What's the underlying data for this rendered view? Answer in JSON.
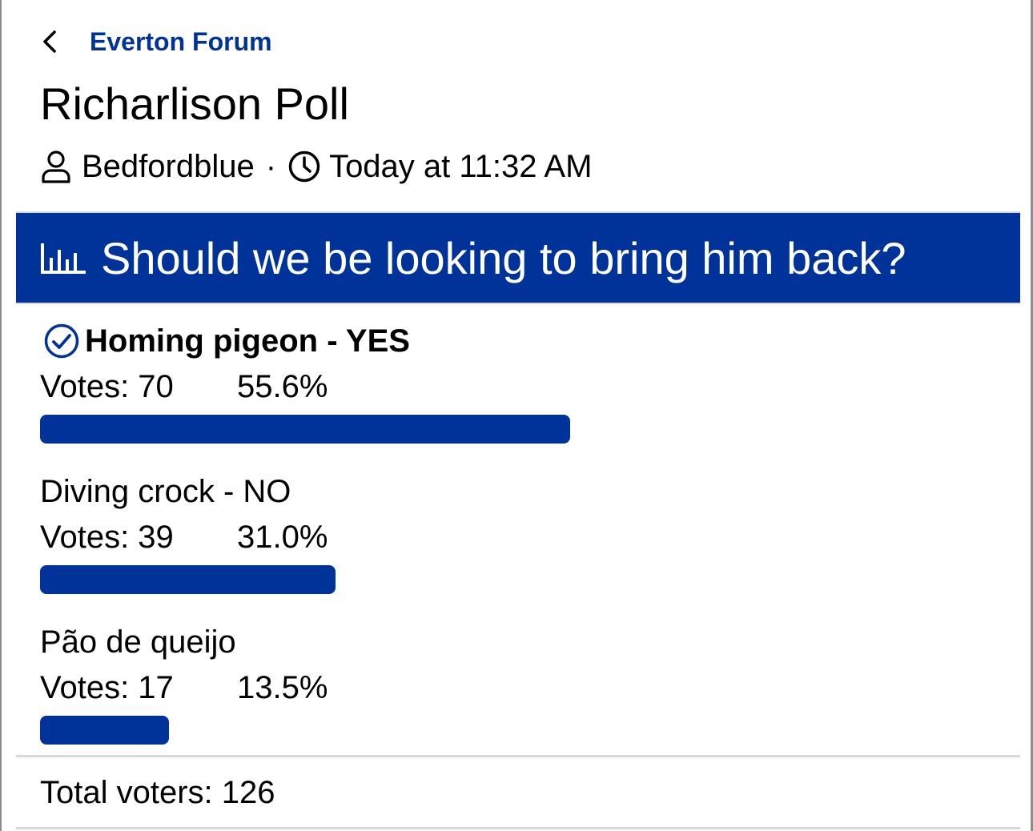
{
  "breadcrumb": {
    "forum_name": "Everton Forum"
  },
  "thread": {
    "title": "Richarlison Poll",
    "author": "Bedfordblue",
    "separator": "·",
    "posted": "Today at 11:32 AM"
  },
  "poll": {
    "question": "Should we be looking to bring him back?",
    "options": [
      {
        "label": "Homing pigeon - YES",
        "votes_text": "Votes: 70",
        "percent_text": "55.6%",
        "fraction": 0.556,
        "voted": true
      },
      {
        "label": "Diving crock - NO",
        "votes_text": "Votes: 39",
        "percent_text": "31.0%",
        "fraction": 0.31,
        "voted": false
      },
      {
        "label": "Pão de queijo",
        "votes_text": "Votes: 17",
        "percent_text": "13.5%",
        "fraction": 0.135,
        "voted": false
      }
    ],
    "total_voters": "Total voters: 126"
  },
  "colors": {
    "accent": "#003399",
    "divider": "#d8d8d8"
  },
  "icons": {
    "back": "chevron-left-icon",
    "author": "user-icon",
    "time": "clock-icon",
    "poll": "bar-chart-icon",
    "voted": "check-circle-icon"
  }
}
